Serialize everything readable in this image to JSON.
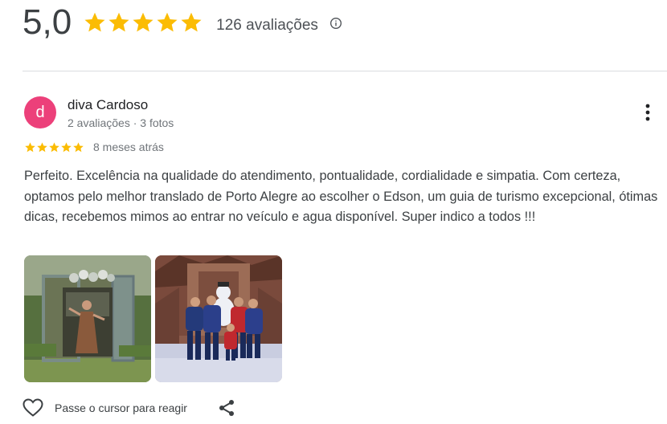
{
  "summary": {
    "score": "5,0",
    "stars_filled": 5,
    "count_label": "126 avaliações",
    "info_icon": "info-icon"
  },
  "review": {
    "avatar_letter": "d",
    "avatar_color": "#ec407a",
    "name": "diva Cardoso",
    "meta": "2 avaliações · 3 fotos",
    "rating": 5,
    "time": "8 meses atrás",
    "text": "Perfeito. Excelência na qualidade do atendimento, pontualidade, cordialidade e simpatia. Com certeza, optamos pelo melhor translado de Porto Alegre ao escolher o Edson, um guia de turismo excepcional, ótimas dicas, recebemos mimos ao entrar no veículo e agua disponível. Super indico a todos !!!",
    "photos": [
      "photo-garden-door",
      "photo-snow-park-group"
    ]
  },
  "actions": {
    "react_label": "Passe o cursor para reagir",
    "heart_icon": "heart-icon",
    "share_icon": "share-icon"
  },
  "colors": {
    "star": "#fbbc04",
    "text": "#3c4043",
    "muted": "#70757a",
    "divider": "#dadce0"
  }
}
